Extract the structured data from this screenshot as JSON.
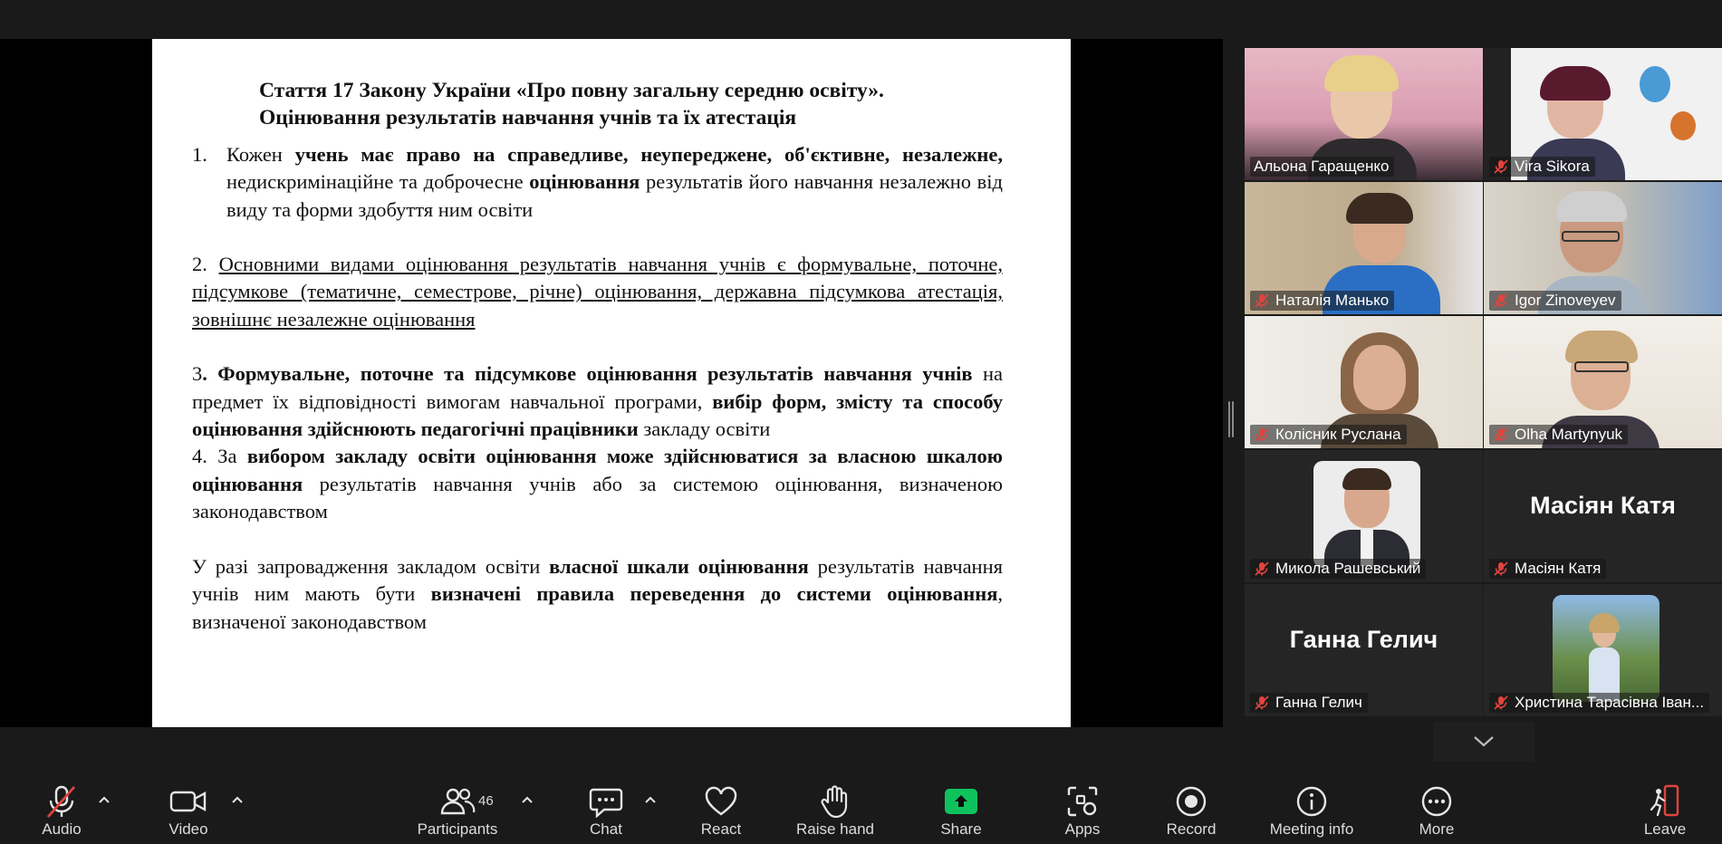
{
  "slide": {
    "title_line1": "Стаття 17 Закону України «Про повну загальну середню освіту».",
    "title_line2": "Оцінювання результатів навчання учнів та їх  атестація",
    "p1": {
      "number": "1.",
      "t1": "Кожен ",
      "b1": "учень має право на справедливе, неупереджене, об'єктивне, незалежне,",
      "t2": " недискримінаційне та доброчесне ",
      "b2": "оцінювання",
      "t3": " результатів його навчання незалежно від виду та форми здобуття ним освіти"
    },
    "p2": {
      "number": "2. ",
      "u1": "Основними видами оцінювання результатів навчання учнів є формувальне, поточне, підсумкове (тематичне, семестрове, річне) оцінювання, державна підсумкова атестація, зовнішнє незалежне оцінювання"
    },
    "p3": {
      "number": "3",
      "b1": ". Формувальне, поточне та підсумкове оцінювання результатів навчання учнів",
      "t1": " на предмет їх відповідності вимогам навчальної програми, ",
      "b2": "вибір форм, змісту та способу оцінювання здійснюють педагогічні працівники",
      "t2": " закладу освіти"
    },
    "p4": {
      "t1": "4. За ",
      "b1": "вибором закладу освіти оцінювання може здійснюватися за власною шкалою оцінювання",
      "t2": " результатів навчання учнів або за системою оцінювання, визначеною законодавством"
    },
    "p5": {
      "t1": "У разі запровадження закладом освіти ",
      "b1": "власної шкали оцінювання",
      "t2": " результатів навчання учнів ним мають бути ",
      "b2": "визначені правила переведення до системи оцінювання",
      "t3": ", визначеної законодавством"
    }
  },
  "participants": [
    {
      "name": "Альона Гаращенко",
      "muted": false,
      "speaking": true
    },
    {
      "name": "Vira Sikora",
      "muted": true
    },
    {
      "name": "Наталія Манько",
      "muted": true
    },
    {
      "name": "Igor Zinoveyev",
      "muted": true
    },
    {
      "name": "Колісник Руслана",
      "muted": true
    },
    {
      "name": "Olha Martynyuk",
      "muted": true
    },
    {
      "name": "Микола Рашевський",
      "muted": true
    },
    {
      "name": "Масіян Катя",
      "muted": true,
      "big_label": "Масіян Катя"
    },
    {
      "name": "Ганна Гелич",
      "muted": true,
      "big_label": "Ганна Гелич"
    },
    {
      "name": "Христина Тарасівна Іван...",
      "muted": true
    }
  ],
  "toolbar": {
    "audio": "Audio",
    "video": "Video",
    "participants": "Participants",
    "participants_count": "46",
    "chat": "Chat",
    "react": "React",
    "raise_hand": "Raise hand",
    "share": "Share",
    "apps": "Apps",
    "record": "Record",
    "meeting_info": "Meeting info",
    "more": "More",
    "leave": "Leave"
  },
  "colors": {
    "speaking_border": "#23d959",
    "share_green": "#0fc25d",
    "mute_red": "#e0443e",
    "leave_red": "#e0443e"
  }
}
